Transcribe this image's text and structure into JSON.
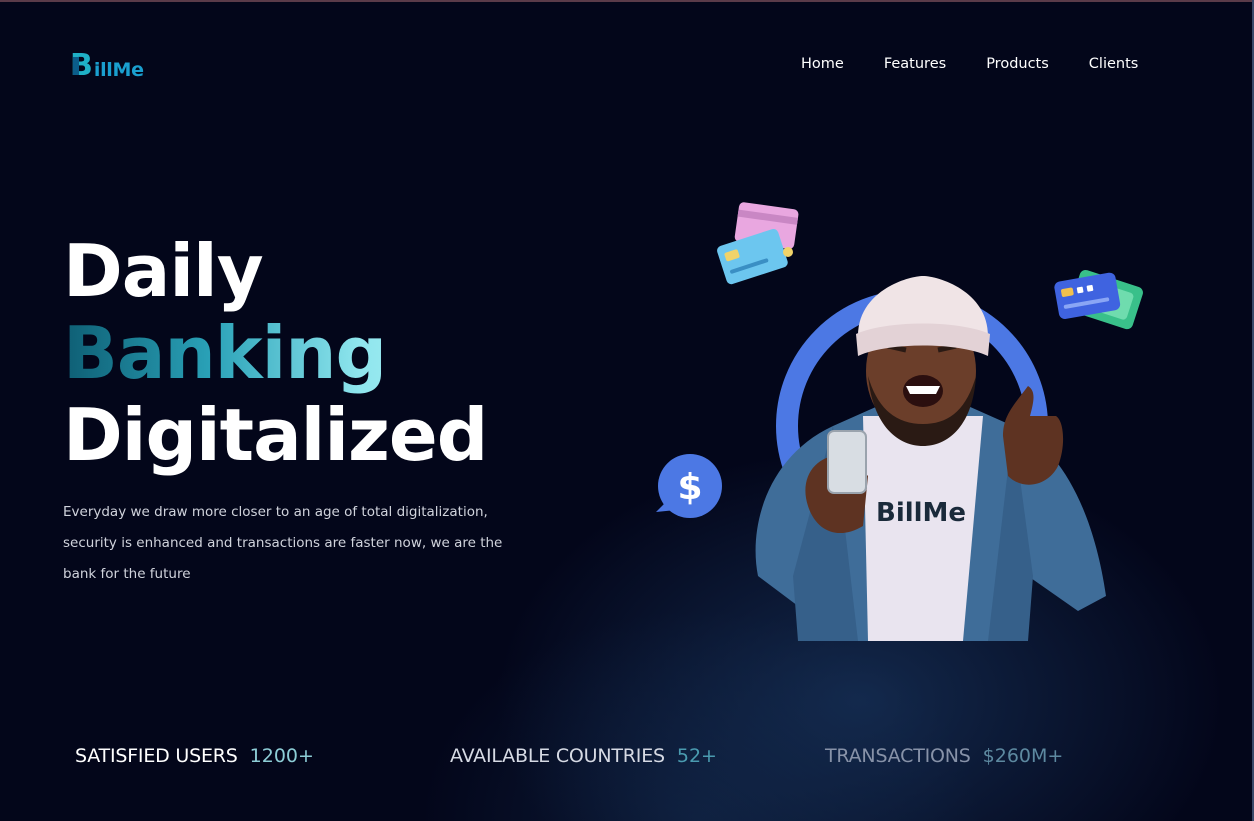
{
  "brand": {
    "logo_initial": "B",
    "logo_rest": "illMe",
    "colors": {
      "primary": "#1fb0c6",
      "dark": "#0b5d8a"
    }
  },
  "nav": {
    "items": [
      {
        "label": "Home"
      },
      {
        "label": "Features"
      },
      {
        "label": "Products"
      },
      {
        "label": "Clients"
      }
    ]
  },
  "hero": {
    "line1": "Daily",
    "line2": "Banking",
    "line3": "Digitalized",
    "description": "Everyday we draw more closer to an age of total digitalization, security is enhanced and transactions are faster now, we are the bank for the future"
  },
  "illustration": {
    "shirt_text": "BillMe",
    "bubble_symbol": "$",
    "icons": [
      "credit-cards-icon",
      "money-card-icon",
      "dollar-chat-bubble-icon"
    ]
  },
  "stats": [
    {
      "label": "SATISFIED USERS",
      "value": "1200+"
    },
    {
      "label": "AVAILABLE COUNTRIES",
      "value": "52+"
    },
    {
      "label": "TRANSACTIONS",
      "value": "$260M+"
    }
  ],
  "theme": {
    "background": "#03061a",
    "accent_ring": "#4c78e4",
    "gradient_start": "#0e5e74",
    "gradient_end": "#b6f1f5"
  }
}
